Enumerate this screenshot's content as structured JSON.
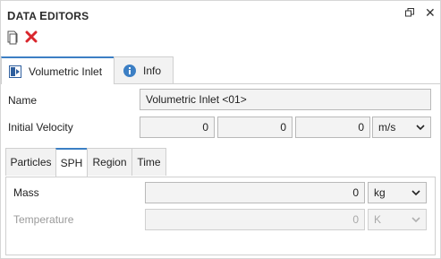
{
  "window": {
    "title_first": "D",
    "title_rest_1": "ATA ",
    "title_second": "E",
    "title_rest_2": "DITORS",
    "restore_icon": "restore-window-icon",
    "close_icon": "close-icon"
  },
  "toolbar": {
    "copy_icon": "copy-icon",
    "delete_icon": "delete-icon"
  },
  "main_tabs": [
    {
      "label": "Volumetric Inlet",
      "icon": "volumetric-inlet-icon",
      "active": true
    },
    {
      "label": "Info",
      "icon": "info-icon",
      "active": false
    }
  ],
  "form": {
    "name_label": "Name",
    "name_value": "Volumetric Inlet <01>",
    "velocity_label": "Initial Velocity",
    "velocity_x": "0",
    "velocity_y": "0",
    "velocity_z": "0",
    "velocity_unit": "m/s"
  },
  "sub_tabs": [
    {
      "label": "Particles",
      "active": false
    },
    {
      "label": "SPH",
      "active": true
    },
    {
      "label": "Region",
      "active": false
    },
    {
      "label": "Time",
      "active": false
    }
  ],
  "sph": {
    "mass_label": "Mass",
    "mass_value": "0",
    "mass_unit": "kg",
    "temperature_label": "Temperature",
    "temperature_value": "0",
    "temperature_unit": "K"
  },
  "colors": {
    "accent": "#3c7fc4",
    "delete": "#d9262c"
  }
}
